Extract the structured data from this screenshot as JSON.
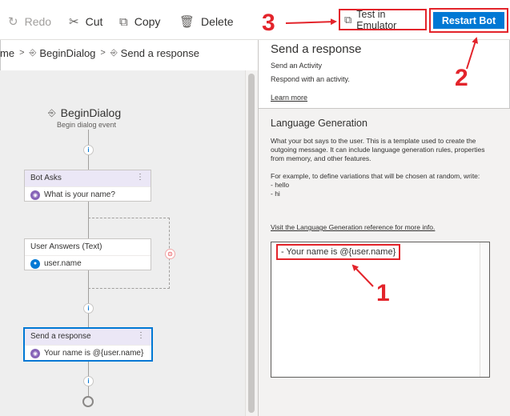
{
  "toolbar": {
    "redo_label": "Redo",
    "cut_label": "Cut",
    "copy_label": "Copy",
    "delete_label": "Delete",
    "emulator_label": "Test in Emulator",
    "restart_label": "Restart Bot"
  },
  "breadcrumb": {
    "items": [
      "me",
      "BeginDialog",
      "Send a response"
    ]
  },
  "flow": {
    "title": "BeginDialog",
    "subtitle": "Begin dialog event",
    "nodes": [
      {
        "header": "Bot Asks",
        "body": "What is your name?",
        "icon_color": "#8764b8"
      },
      {
        "header": "User Answers (Text)",
        "body": "user.name",
        "icon_color": "#0078d4"
      },
      {
        "header": "Send a response",
        "body": "Your name is @{user.name}",
        "icon_color": "#8764b8"
      }
    ]
  },
  "properties": {
    "title": "Send a response",
    "subtitle": "Send an Activity",
    "description": "Respond with an activity.",
    "learn_more": "Learn more"
  },
  "language_generation": {
    "title": "Language Generation",
    "para1": "What your bot says to the user. This is a template used to create the outgoing message. It can include language generation rules, properties from memory, and other features.",
    "para2": "For example, to define variations that will be chosen at random, write:",
    "ex1": "- hello",
    "ex2": "- hi",
    "reference_link": "Visit the Language Generation reference for more info.",
    "editor_value": "- Your name is @{user.name}"
  },
  "annotations": {
    "n1": "1",
    "n2": "2",
    "n3": "3",
    "color": "#e3242b"
  },
  "colors": {
    "accent": "#0078d4"
  }
}
